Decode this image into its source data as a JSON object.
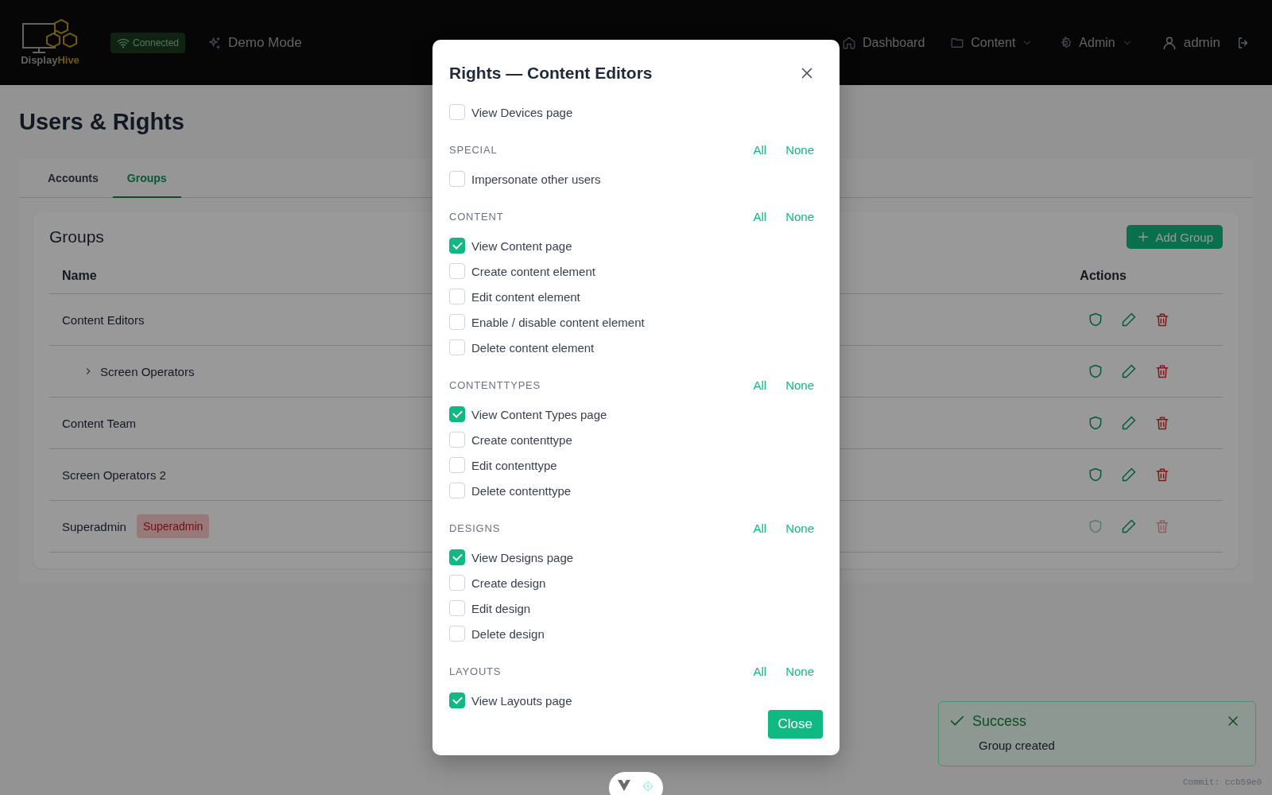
{
  "header": {
    "logo": {
      "first": "Display",
      "second": "Hive"
    },
    "status": "Connected",
    "mode": "Demo Mode",
    "nav": [
      {
        "label": "Dashboard",
        "dropdown": false
      },
      {
        "label": "Content",
        "dropdown": true
      },
      {
        "label": "Admin",
        "dropdown": true
      }
    ],
    "user": "admin"
  },
  "page": {
    "title": "Users & Rights"
  },
  "tabs": [
    {
      "label": "Accounts",
      "selected": false
    },
    {
      "label": "Groups",
      "selected": true
    }
  ],
  "groups": {
    "title": "Groups",
    "add_button": "Add Group",
    "columns": [
      "Name",
      "Actions"
    ],
    "rows": [
      {
        "name": "Content Editors",
        "locked": false,
        "children": [
          {
            "name": "Screen Operators",
            "expanded": false,
            "locked": false
          }
        ]
      },
      {
        "name": "Content Team",
        "locked": false
      },
      {
        "name": "Screen Operators 2",
        "locked": false
      },
      {
        "name": "Superadmin",
        "badge": "Superadmin",
        "locked": true
      }
    ]
  },
  "dialog": {
    "title": "Rights — Content Editors",
    "sections": [
      {
        "items": [
          {
            "label": "View Devices page",
            "checked": false
          }
        ]
      },
      {
        "title": "SPECIAL",
        "all": "All",
        "none": "None",
        "items": [
          {
            "label": "Impersonate other users",
            "checked": false
          }
        ]
      },
      {
        "title": "CONTENT",
        "all": "All",
        "none": "None",
        "items": [
          {
            "label": "View Content page",
            "checked": true
          },
          {
            "label": "Create content element",
            "checked": false
          },
          {
            "label": "Edit content element",
            "checked": false
          },
          {
            "label": "Enable / disable content element",
            "checked": false
          },
          {
            "label": "Delete content element",
            "checked": false
          }
        ]
      },
      {
        "title": "CONTENTTYPES",
        "all": "All",
        "none": "None",
        "items": [
          {
            "label": "View Content Types page",
            "checked": true
          },
          {
            "label": "Create contenttype",
            "checked": false
          },
          {
            "label": "Edit contenttype",
            "checked": false
          },
          {
            "label": "Delete contenttype",
            "checked": false
          }
        ]
      },
      {
        "title": "DESIGNS",
        "all": "All",
        "none": "None",
        "items": [
          {
            "label": "View Designs page",
            "checked": true
          },
          {
            "label": "Create design",
            "checked": false
          },
          {
            "label": "Edit design",
            "checked": false
          },
          {
            "label": "Delete design",
            "checked": false
          }
        ]
      },
      {
        "title": "LAYOUTS",
        "all": "All",
        "none": "None",
        "items": [
          {
            "label": "View Layouts page",
            "checked": true
          }
        ]
      }
    ],
    "close": "Close"
  },
  "toast": {
    "title": "Success",
    "message": "Group created"
  },
  "commit": "Commit: ccb59e0"
}
